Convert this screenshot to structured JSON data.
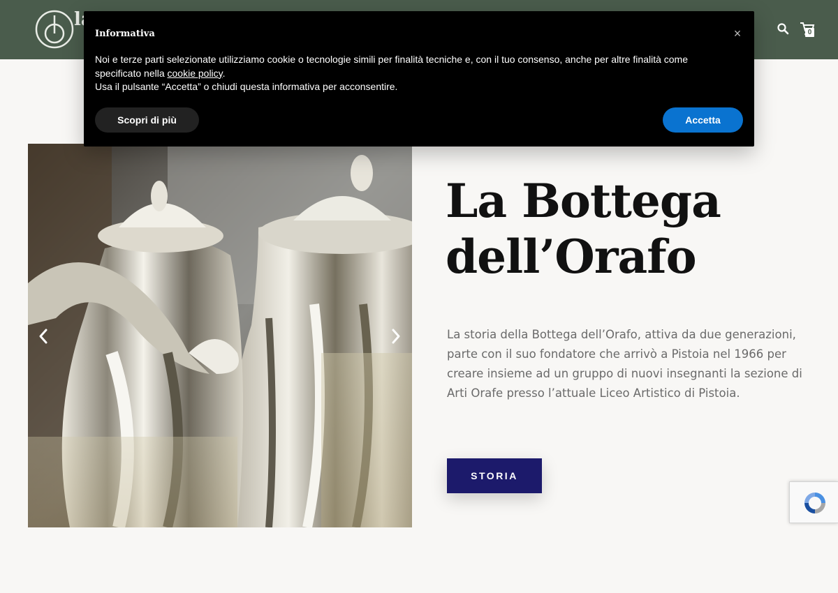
{
  "header": {
    "logo_text": "la d",
    "search_icon": "search-icon",
    "cart_icon": "cart-icon",
    "cart_count": "0",
    "background_color": "#4a5c4c"
  },
  "slider": {
    "prev_icon": "chevron-left-icon",
    "next_icon": "chevron-right-icon"
  },
  "hero": {
    "title_line1": "La Bottega",
    "title_line2": "dell’Orafo",
    "description": "La storia della Bottega dell’Orafo, attiva da due generazioni, parte con il suo fondatore che arrivò a Pistoia nel 1966 per creare insieme ad un gruppo di nuovi insegnanti la sezione di Arti Orafe presso l’attuale Liceo Artistico di Pistoia.",
    "button_label": "STORIA",
    "button_color": "#1c1a6b"
  },
  "cookie_banner": {
    "title": "Informativa",
    "close_label": "×",
    "text_before_link": "Noi e terze parti selezionate utilizziamo cookie o tecnologie simili per finalità tecniche e, con il tuo consenso, anche per altre finalità come specificato nella ",
    "link_text": "cookie policy",
    "text_after_link": ".",
    "text_line2": "Usa il pulsante “Accetta” o chiudi questa informativa per acconsentire.",
    "learn_more_label": "Scopri di più",
    "accept_label": "Accetta",
    "accept_color": "#0a73d0"
  },
  "recaptcha": {
    "icon": "recaptcha-icon"
  }
}
